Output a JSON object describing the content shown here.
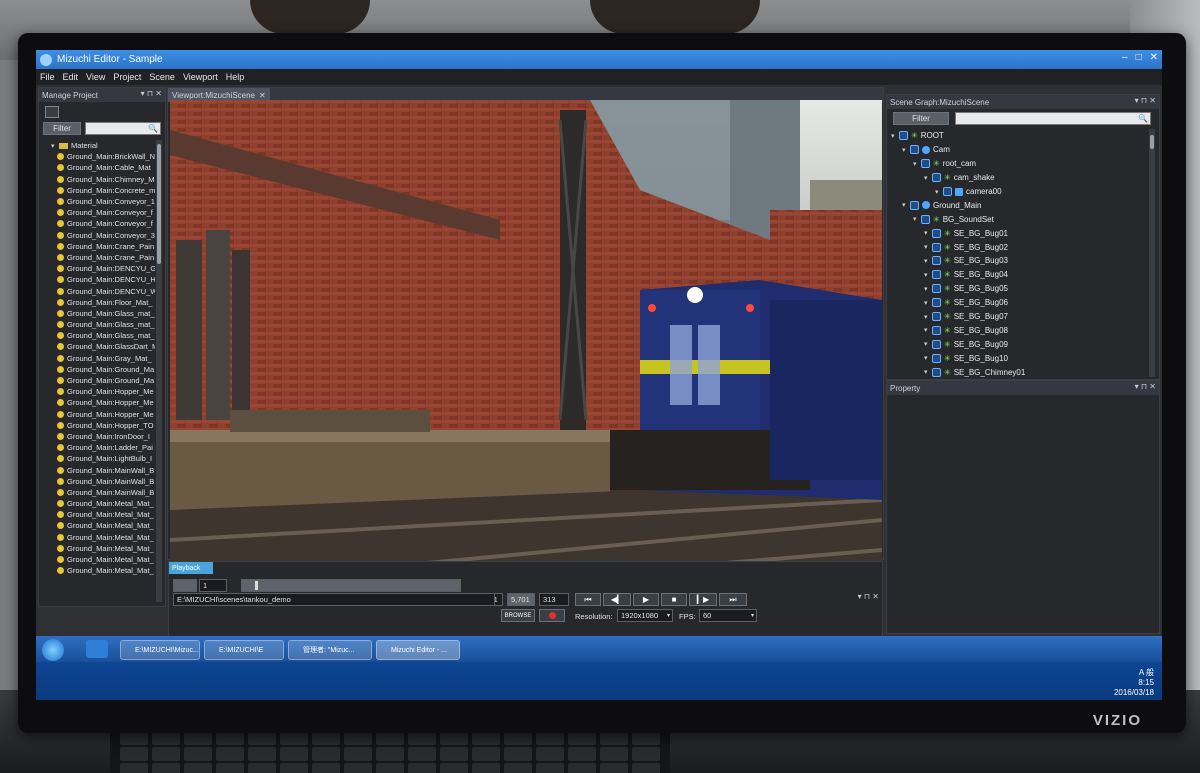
{
  "window": {
    "title": "Mizuchi Editor - Sample",
    "controls": [
      "–",
      "□",
      "✕"
    ]
  },
  "menu": [
    "File",
    "Edit",
    "View",
    "Project",
    "Scene",
    "Viewport",
    "Help"
  ],
  "manage_project": {
    "title": "Manage Project",
    "filter_label": "Filter",
    "filter_value": "",
    "tree_root": "Material",
    "items": [
      "Ground_Main:BrickWall_N",
      "Ground_Main:Cable_Mat",
      "Ground_Main:Chimney_M",
      "Ground_Main:Concrete_m",
      "Ground_Main:Conveyor_1",
      "Ground_Main:Conveyor_f",
      "Ground_Main:Conveyor_f",
      "Ground_Main:Conveyor_3",
      "Ground_Main:Crane_Pain",
      "Ground_Main:Crane_Pain",
      "Ground_Main:DENCYU_G",
      "Ground_Main:DENCYU_H",
      "Ground_Main:DENCYU_W",
      "Ground_Main:Floor_Mat_",
      "Ground_Main:Glass_mat_",
      "Ground_Main:Glass_mat_",
      "Ground_Main:Glass_mat_",
      "Ground_Main:GlassDart_M",
      "Ground_Main:Gray_Mat_",
      "Ground_Main:Ground_Ma",
      "Ground_Main:Ground_Ma",
      "Ground_Main:Hopper_Me",
      "Ground_Main:Hopper_Me",
      "Ground_Main:Hopper_Me",
      "Ground_Main:Hopper_TO",
      "Ground_Main:IronDoor_I",
      "Ground_Main:Ladder_Pai",
      "Ground_Main:LightBulb_I",
      "Ground_Main:MainWall_B",
      "Ground_Main:MainWall_B",
      "Ground_Main:MainWall_B",
      "Ground_Main:Metal_Mat_",
      "Ground_Main:Metal_Mat_",
      "Ground_Main:Metal_Mat_",
      "Ground_Main:Metal_Mat_",
      "Ground_Main:Metal_Mat_",
      "Ground_Main:Metal_Mat_",
      "Ground_Main:Metal_Mat_"
    ]
  },
  "viewport": {
    "tab_label": "Viewport:MizuchiScene",
    "colors": {
      "brick": "#8b3a2a",
      "sky": "#d8dcd8",
      "train_body": "#1f2d6e",
      "stripe": "#c6c423",
      "rail": "#4a4039"
    }
  },
  "scene_graph": {
    "title": "Scene Graph:MizuchiScene",
    "filter_label": "Filter",
    "nodes": [
      {
        "label": "ROOT",
        "depth": 0,
        "kind": "star"
      },
      {
        "label": "Cam",
        "depth": 1,
        "kind": "node"
      },
      {
        "label": "root_cam",
        "depth": 2,
        "kind": "star"
      },
      {
        "label": "cam_shake",
        "depth": 3,
        "kind": "star"
      },
      {
        "label": "camera00",
        "depth": 4,
        "kind": "camera"
      },
      {
        "label": "Ground_Main",
        "depth": 1,
        "kind": "node"
      },
      {
        "label": "BG_SoundSet",
        "depth": 2,
        "kind": "star"
      },
      {
        "label": "SE_BG_Bug01",
        "depth": 3,
        "kind": "star"
      },
      {
        "label": "SE_BG_Bug02",
        "depth": 3,
        "kind": "star"
      },
      {
        "label": "SE_BG_Bug03",
        "depth": 3,
        "kind": "star"
      },
      {
        "label": "SE_BG_Bug04",
        "depth": 3,
        "kind": "star"
      },
      {
        "label": "SE_BG_Bug05",
        "depth": 3,
        "kind": "star"
      },
      {
        "label": "SE_BG_Bug06",
        "depth": 3,
        "kind": "star"
      },
      {
        "label": "SE_BG_Bug07",
        "depth": 3,
        "kind": "star"
      },
      {
        "label": "SE_BG_Bug08",
        "depth": 3,
        "kind": "star"
      },
      {
        "label": "SE_BG_Bug09",
        "depth": 3,
        "kind": "star"
      },
      {
        "label": "SE_BG_Bug10",
        "depth": 3,
        "kind": "star"
      },
      {
        "label": "SE_BG_Chimney01",
        "depth": 3,
        "kind": "star"
      }
    ]
  },
  "property": {
    "title": "Property"
  },
  "playback": {
    "tab_label": "Playback",
    "start_frame": "1",
    "end_frame": "5,701",
    "current_frame_box": "5,701",
    "frame_counter": "313",
    "path": "E:\\MIZUCHI\\scenes\\tankou_demo",
    "browse_label": "BROWSE",
    "transport": [
      "⏮",
      "◀▎",
      "▶",
      "■",
      "▎▶",
      "⏭"
    ],
    "resolution_label": "Resolution:",
    "resolution_value": "1920x1080",
    "fps_label": "FPS:",
    "fps_value": "60"
  },
  "taskbar": {
    "items": [
      "E:\\MIZUCHI\\Mizuc...",
      "E:\\MIZUCHI\\E",
      "管理者: \"Mizuc...",
      "Mizuchi Editor - ..."
    ],
    "time": "8:15",
    "date": "2016/03/18",
    "ime": "A 般"
  },
  "monitor": {
    "brand": "VIZIO"
  }
}
